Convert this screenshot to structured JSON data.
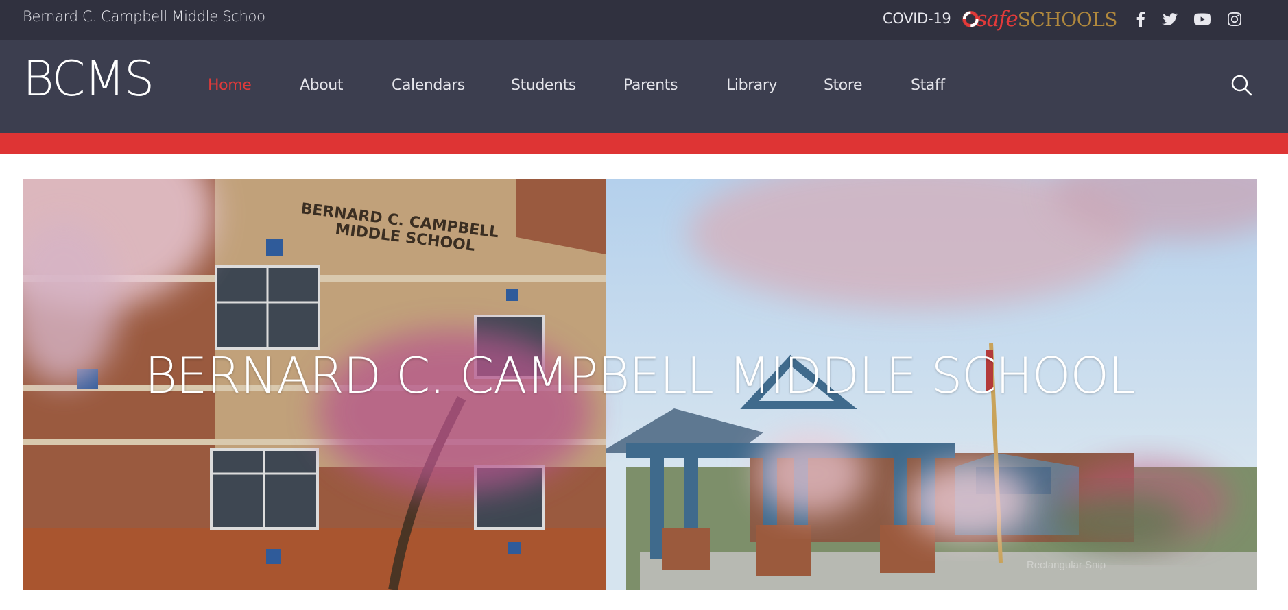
{
  "topbar": {
    "school_name": "Bernard C. Campbell Middle School",
    "covid_link": "COVID-19",
    "safeschools_logo": {
      "part1": "safe",
      "part2": "SCHOOLS"
    },
    "social_icons": [
      "facebook-icon",
      "twitter-icon",
      "youtube-icon",
      "instagram-icon"
    ]
  },
  "header": {
    "logo": "BCMS",
    "nav": [
      {
        "label": "Home",
        "active": true
      },
      {
        "label": "About"
      },
      {
        "label": "Calendars"
      },
      {
        "label": "Students"
      },
      {
        "label": "Parents"
      },
      {
        "label": "Library"
      },
      {
        "label": "Store"
      },
      {
        "label": "Staff"
      }
    ],
    "search_icon": "search-icon"
  },
  "hero": {
    "title": "BERNARD C. CAMPBELL MIDDLE SCHOOL",
    "building_sign_line1": "BERNARD C. CAMPBELL",
    "building_sign_line2": "MIDDLE SCHOOL",
    "caption": "Rectangular Snip"
  },
  "colors": {
    "topbar_bg": "#30313f",
    "navbar_bg": "#3c3e4f",
    "accent_red": "#de3434",
    "active_nav": "#e03a3a"
  }
}
